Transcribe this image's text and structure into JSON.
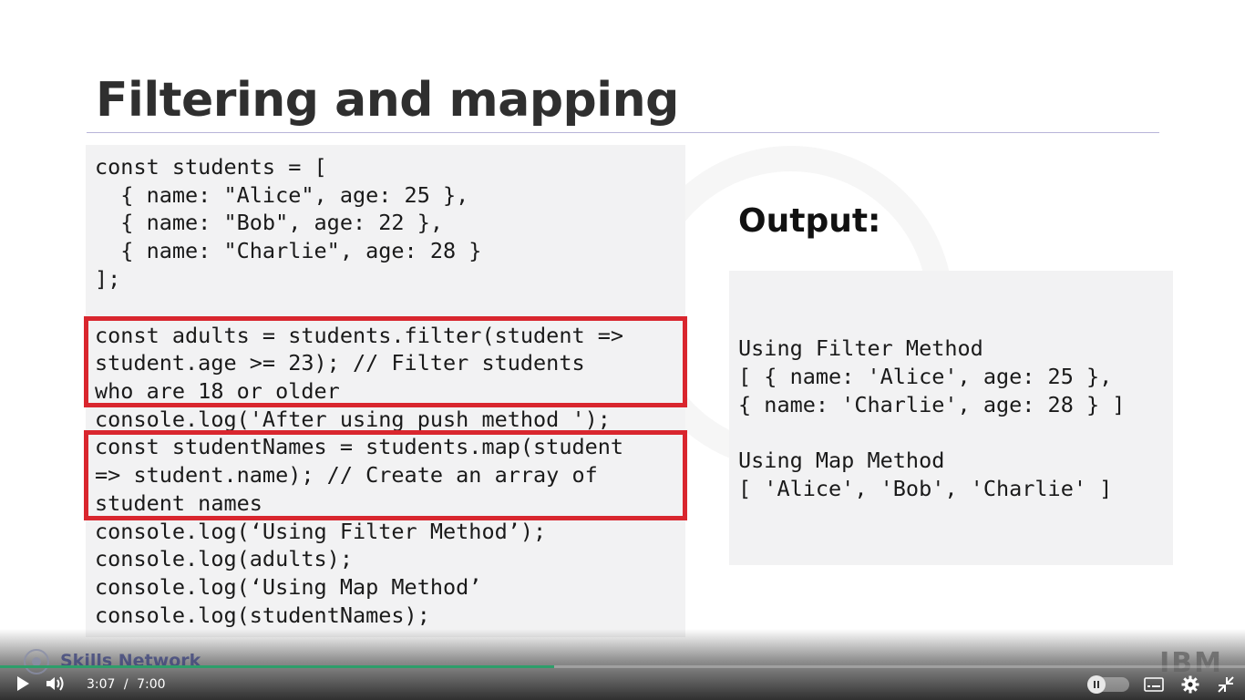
{
  "slide": {
    "title": "Filtering and mapping",
    "code_lines": [
      "const students = [",
      "  { name: \"Alice\", age: 25 },",
      "  { name: \"Bob\", age: 22 },",
      "  { name: \"Charlie\", age: 28 }",
      "];",
      "",
      "const adults = students.filter(student =>",
      "student.age >= 23); // Filter students",
      "who are 18 or older",
      "console.log('After using push method ');",
      "const studentNames = students.map(student",
      "=> student.name); // Create an array of",
      "student names",
      "console.log(‘Using Filter Method’);",
      "console.log(adults);",
      "console.log(‘Using Map Method’",
      "console.log(studentNames);"
    ],
    "output_label": "Output:",
    "output_lines": [
      "Using Filter Method",
      "[ { name: 'Alice', age: 25 },",
      "{ name: 'Charlie', age: 28 } ]",
      "",
      "Using Map Method",
      "[ 'Alice', 'Bob', 'Charlie' ]"
    ],
    "highlight_color": "#d9262e"
  },
  "branding": {
    "name": "Skills Network",
    "logo": "IBM"
  },
  "player": {
    "current_time": "3:07",
    "separator": "/",
    "duration": "7:00",
    "progress": 0.445,
    "progress_color": "#2e9e6a",
    "icons": {
      "play": "play-icon",
      "volume": "volume-icon",
      "pause_toggle": "pause-icon",
      "captions": "captions-icon",
      "settings": "gear-icon",
      "exit_fullscreen": "exit-fullscreen-icon"
    }
  }
}
